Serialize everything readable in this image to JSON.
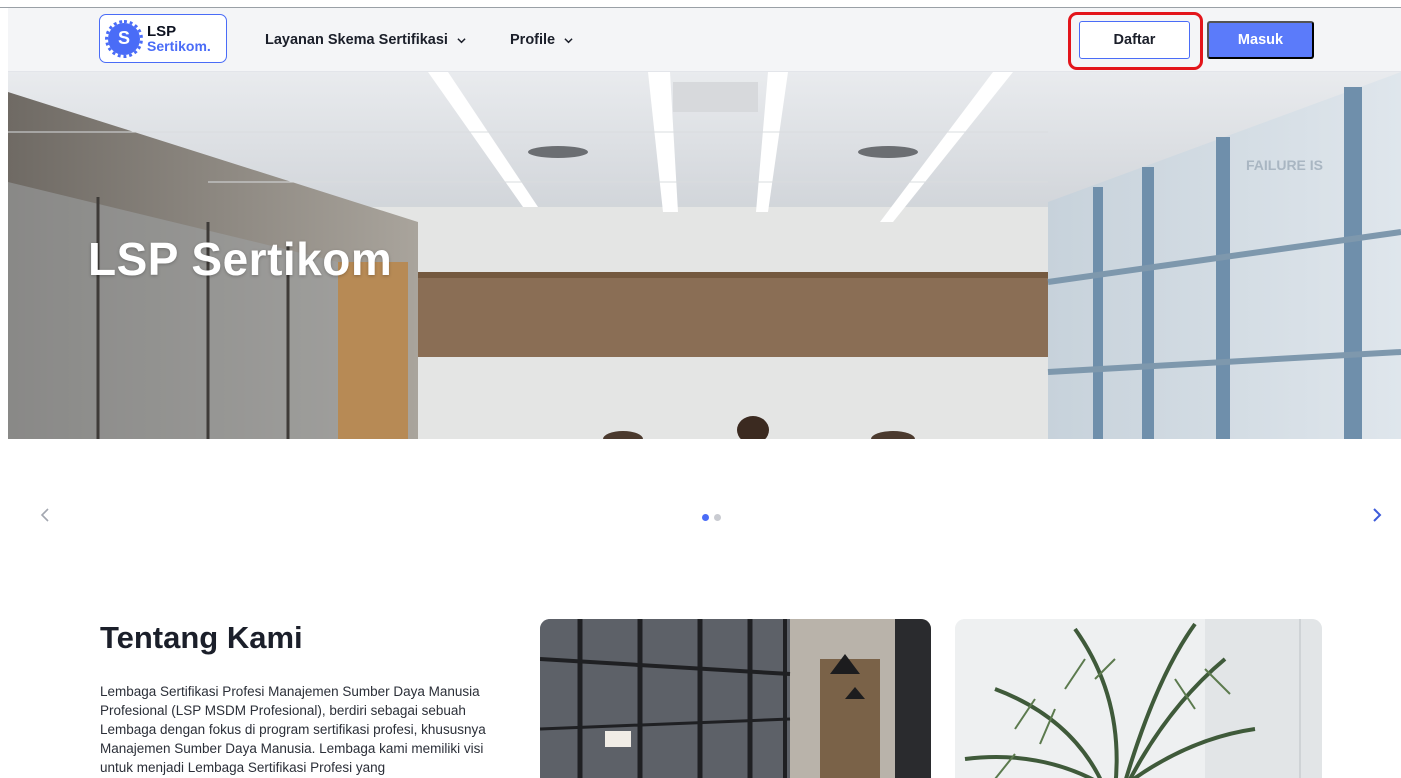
{
  "header": {
    "logo": {
      "line1": "LSP",
      "line2": "Sertikom.",
      "badge": "S"
    },
    "nav": [
      {
        "label": "Layanan Skema Sertifikasi"
      },
      {
        "label": "Profile"
      }
    ],
    "daftar_label": "Daftar",
    "masuk_label": "Masuk"
  },
  "hero": {
    "title": "LSP Sertikom",
    "wall_sign": "FAILURE IS"
  },
  "carousel": {
    "slide_count": 2,
    "active_index": 0
  },
  "about": {
    "title": "Tentang Kami",
    "text": "Lembaga Sertifikasi Profesi Manajemen Sumber Daya Manusia Profesional (LSP MSDM Profesional), berdiri sebagai sebuah Lembaga dengan fokus di program sertifikasi profesi, khususnya Manajemen Sumber Daya Manusia. Lembaga kami memiliki visi untuk menjadi Lembaga Sertifikasi Profesi yang"
  },
  "colors": {
    "accent": "#4a6cf7",
    "highlight": "#e3151b"
  },
  "icons": {
    "nav_dropdown": "chevron-down-icon",
    "prev": "chevron-left-icon",
    "next": "chevron-right-icon"
  }
}
